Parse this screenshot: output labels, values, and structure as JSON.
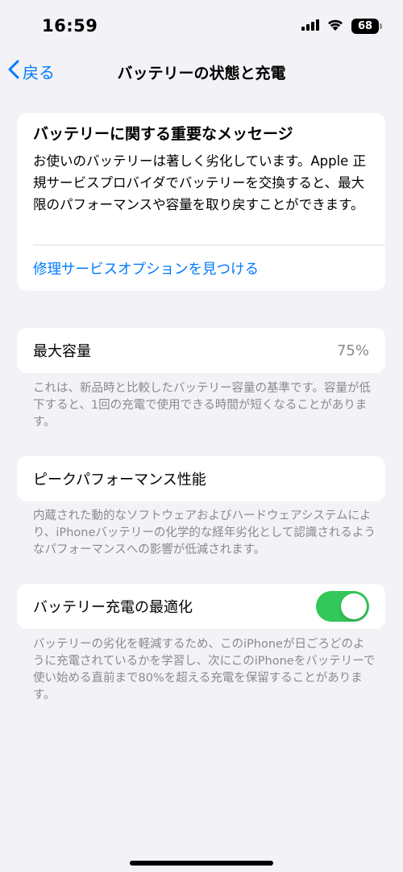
{
  "status_bar": {
    "time": "16:59",
    "battery_level": "68",
    "icons": [
      "signal-icon",
      "wifi-icon",
      "battery-icon"
    ]
  },
  "nav": {
    "back_label": "戻る",
    "title": "バッテリーの状態と充電"
  },
  "message_card": {
    "title": "バッテリーに関する重要なメッセージ",
    "body": "お使いのバッテリーは著しく劣化しています。Apple 正規サービスプロバイダでバッテリーを交換すると、最大限のパフォーマンスや容量を取り戻すことができます。",
    "link_label": "修理サービスオプションを見つける"
  },
  "capacity": {
    "label": "最大容量",
    "value": "75%",
    "note": "これは、新品時と比較したバッテリー容量の基準です。容量が低下すると、1回の充電で使用できる時間が短くなることがあります。"
  },
  "performance": {
    "label": "ピークパフォーマンス性能",
    "note": "内蔵された動的なソフトウェアおよびハードウェアシステムにより、iPhoneバッテリーの化学的な経年劣化として認識されるようなパフォーマンスへの影響が低減されます。"
  },
  "optimize": {
    "label": "バッテリー充電の最適化",
    "enabled": true,
    "note": "バッテリーの劣化を軽減するため、このiPhoneが日ごろどのように充電されているかを学習し、次にこのiPhoneをバッテリーで使い始める直前まで80%を超える充電を保留することがあります。"
  },
  "colors": {
    "accent": "#007aff",
    "toggle_on": "#34c759",
    "background": "#f2f2f7",
    "secondary_text": "#8a8a8e"
  }
}
